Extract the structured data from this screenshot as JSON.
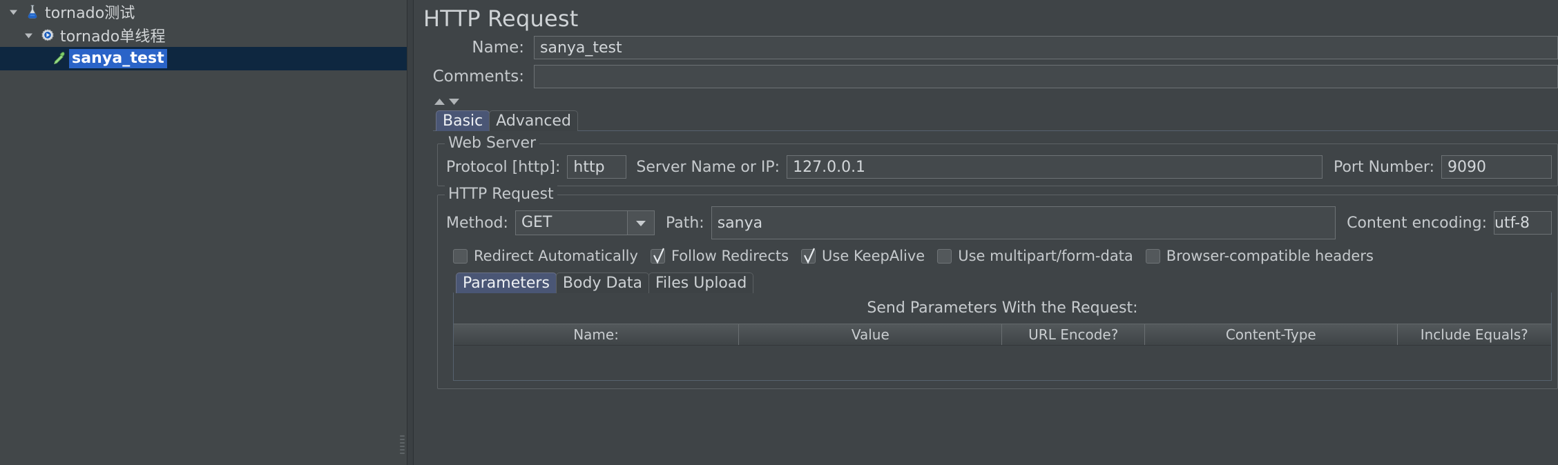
{
  "window": {
    "background_color": "#3f4447",
    "accent_color": "#2a64c8",
    "selected_row_color": "#0e2740"
  },
  "sidebar": {
    "tree": [
      {
        "label": "tornado测试",
        "icon": "flask-icon",
        "expanded": true,
        "depth": 0,
        "selected": false
      },
      {
        "label": "tornado单线程",
        "icon": "gear-play-icon",
        "expanded": true,
        "depth": 1,
        "selected": false
      },
      {
        "label": "sanya_test",
        "icon": "pipette-icon",
        "expanded": null,
        "depth": 2,
        "selected": true
      }
    ]
  },
  "main": {
    "title": "HTTP Request",
    "name_label": "Name:",
    "name_value": "sanya_test",
    "comments_label": "Comments:",
    "comments_value": "",
    "collapse_up_icon": "triangle-up-icon",
    "collapse_down_icon": "triangle-down-icon",
    "tabs": [
      {
        "label": "Basic",
        "active": true
      },
      {
        "label": "Advanced",
        "active": false
      }
    ],
    "web_server": {
      "group_title": "Web Server",
      "protocol_label": "Protocol [http]:",
      "protocol_value": "http",
      "server_label": "Server Name or IP:",
      "server_value": "127.0.0.1",
      "port_label": "Port Number:",
      "port_value": "9090"
    },
    "http_request": {
      "group_title": "HTTP Request",
      "method_label": "Method:",
      "method_value": "GET",
      "method_arrow_icon": "chevron-down-icon",
      "path_label": "Path:",
      "path_value": "sanya",
      "encoding_label": "Content encoding:",
      "encoding_value": "utf-8"
    },
    "checkboxes": [
      {
        "label": "Redirect Automatically",
        "checked": false
      },
      {
        "label": "Follow Redirects",
        "checked": true
      },
      {
        "label": "Use KeepAlive",
        "checked": true
      },
      {
        "label": "Use multipart/form-data",
        "checked": false
      },
      {
        "label": "Browser-compatible headers",
        "checked": false
      }
    ],
    "param_tabs": [
      {
        "label": "Parameters",
        "active": true
      },
      {
        "label": "Body Data",
        "active": false
      },
      {
        "label": "Files Upload",
        "active": false
      }
    ],
    "param_table": {
      "caption": "Send Parameters With the Request:",
      "columns": [
        "Name:",
        "Value",
        "URL Encode?",
        "Content-Type",
        "Include Equals?"
      ],
      "rows": []
    }
  }
}
